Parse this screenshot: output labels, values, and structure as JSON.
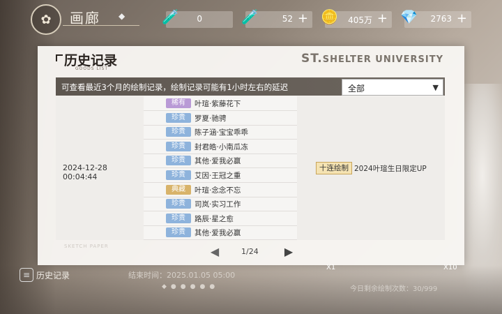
{
  "topbar": {
    "title": "画廊",
    "resources": [
      {
        "icon": "tube-icon",
        "value": "0"
      },
      {
        "icon": "tube-icon",
        "value": "52"
      },
      {
        "icon": "coin-icon",
        "value": "405万"
      },
      {
        "icon": "diamond-icon",
        "value": "2763"
      }
    ],
    "plus": "+"
  },
  "panel": {
    "title": "历史记录",
    "subtitle": "GOODS LIST",
    "brand_prefix": "ST.",
    "brand_rest": "SHELTER UNIVERSITY",
    "info": "可查看最近3个月的绘制记录，绘制记录可能有1小时左右的延迟",
    "filter": "全部",
    "record": {
      "time": "2024-12-28  00:04:44",
      "type": "十连绘制",
      "pool": "2024叶瑄生日限定UP",
      "items": [
        {
          "rarity": "稀有",
          "kind": "rare",
          "name": "叶瑄·紫藤花下"
        },
        {
          "rarity": "珍贵",
          "kind": "prec",
          "name": "罗夏·驰骋"
        },
        {
          "rarity": "珍贵",
          "kind": "prec",
          "name": "陈子涵·宝宝乖乖"
        },
        {
          "rarity": "珍贵",
          "kind": "prec",
          "name": "封君皓·小南瓜冻"
        },
        {
          "rarity": "珍贵",
          "kind": "prec",
          "name": "其他·爱我必赢"
        },
        {
          "rarity": "珍贵",
          "kind": "prec",
          "name": "艾因·王冠之重"
        },
        {
          "rarity": "典藏",
          "kind": "coll",
          "name": "叶瑄·念念不忘"
        },
        {
          "rarity": "珍贵",
          "kind": "prec",
          "name": "司岚·实习工作"
        },
        {
          "rarity": "珍贵",
          "kind": "prec",
          "name": "路辰·星之愈"
        },
        {
          "rarity": "珍贵",
          "kind": "prec",
          "name": "其他·爱我必赢"
        }
      ]
    },
    "watermark": "SKETCH PAPER",
    "page": "1/24"
  },
  "bottom": {
    "history_label": "历史记录",
    "end_time": "结束时间：2025.01.05  05:00",
    "x1": "X1",
    "x10": "X10",
    "remaining": "今日剩余绘制次数：30/999"
  }
}
